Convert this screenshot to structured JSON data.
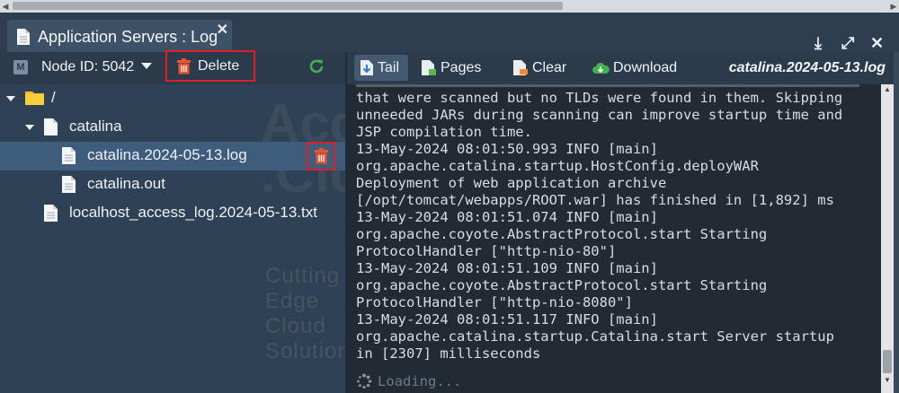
{
  "tab": {
    "title": "Application Servers : Log",
    "close": "✕"
  },
  "window_controls": {
    "download": "⤓",
    "expand": "⤢",
    "close": "✕"
  },
  "left_toolbar": {
    "node_badge": "M",
    "node_label": "Node ID: 5042",
    "delete_label": "Delete"
  },
  "tree": {
    "items": [
      {
        "label": "/",
        "type": "folder",
        "expanded": true
      },
      {
        "label": "catalina",
        "type": "file-group",
        "expanded": true
      },
      {
        "label": "catalina.2024-05-13.log",
        "type": "file",
        "selected": true
      },
      {
        "label": "catalina.out",
        "type": "file"
      },
      {
        "label": "localhost_access_log.2024-05-13.txt",
        "type": "file"
      }
    ]
  },
  "watermark": {
    "line1": "AccuWeb",
    "line2": ".Cloud",
    "tagline": "Cutting Edge Cloud Solutions"
  },
  "right_toolbar": {
    "tail": "Tail",
    "pages": "Pages",
    "clear": "Clear",
    "download": "Download",
    "file_title": "catalina.2024-05-13.log"
  },
  "log": {
    "lines": [
      "that were scanned but no TLDs were found in them. Skipping",
      "unneeded JARs during scanning can improve startup time and",
      "JSP compilation time.",
      "13-May-2024 08:01:50.993 INFO [main]",
      "org.apache.catalina.startup.HostConfig.deployWAR",
      "Deployment of web application archive",
      "[/opt/tomcat/webapps/ROOT.war] has finished in [1,892] ms",
      "13-May-2024 08:01:51.074 INFO [main]",
      "org.apache.coyote.AbstractProtocol.start Starting",
      "ProtocolHandler [\"http-nio-80\"]",
      "13-May-2024 08:01:51.109 INFO [main]",
      "org.apache.coyote.AbstractProtocol.start Starting",
      "ProtocolHandler [\"http-nio-8080\"]",
      "13-May-2024 08:01:51.117 INFO [main]",
      "org.apache.catalina.startup.Catalina.start Server startup",
      "in [2307] milliseconds"
    ],
    "loading": "Loading..."
  },
  "colors": {
    "highlight_border": "#e01e26",
    "refresh": "#3fb24a",
    "folder": "#f2c21b",
    "trash": "#e8552e"
  }
}
